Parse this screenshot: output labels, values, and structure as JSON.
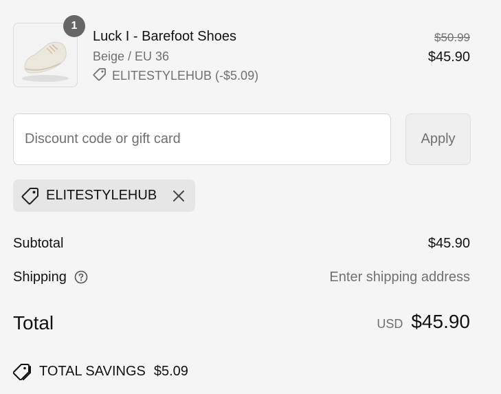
{
  "cart_item": {
    "quantity": "1",
    "name": "Luck I - Barefoot Shoes",
    "variant": "Beige / EU 36",
    "discount_line": "ELITESTYLEHUB (-$5.09)",
    "price_original": "$50.99",
    "price_final": "$45.90",
    "image_icon": "shoe-image"
  },
  "discount_form": {
    "placeholder": "Discount code or gift card",
    "value": "",
    "apply_label": "Apply"
  },
  "applied_code": {
    "code": "ELITESTYLEHUB",
    "icon": "tag-icon",
    "remove_icon": "close-icon"
  },
  "summary": {
    "subtotal_label": "Subtotal",
    "subtotal_value": "$45.90",
    "shipping_label": "Shipping",
    "shipping_value": "Enter shipping address",
    "total_label": "Total",
    "currency": "USD",
    "total_value": "$45.90",
    "savings_label": "TOTAL SAVINGS",
    "savings_value": "$5.09"
  },
  "colors": {
    "background": "#f5f5f5",
    "badge": "#666666",
    "muted_text": "#707070",
    "chip_bg": "#e6e6e6"
  }
}
